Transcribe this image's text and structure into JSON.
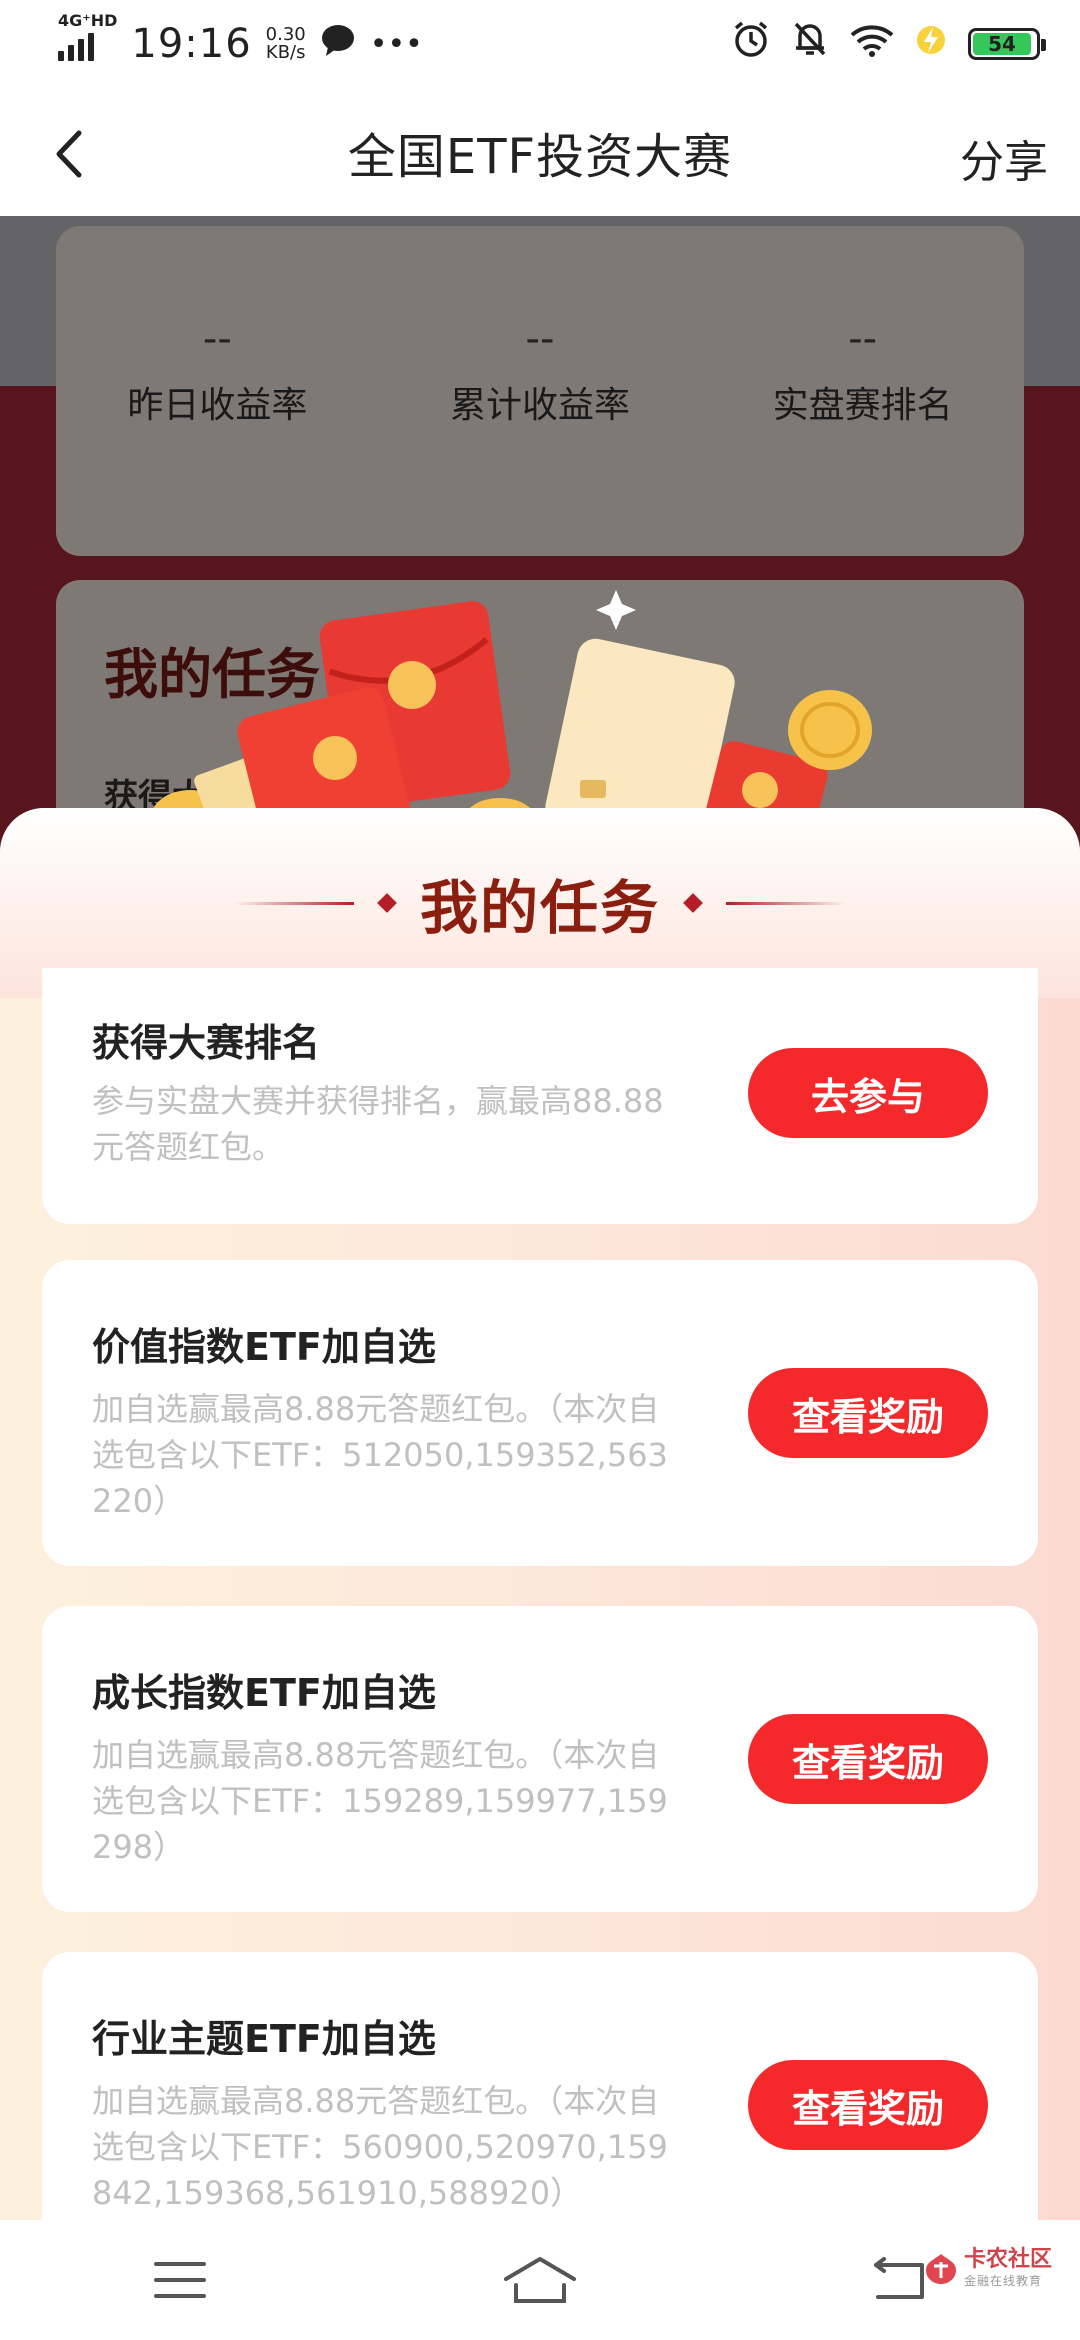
{
  "status_bar": {
    "network": "4G⁺HD",
    "time": "19:16",
    "speed_value": "0.30",
    "speed_unit": "KB/s",
    "more": "•••",
    "battery_level": "54",
    "battery_color": "#35c759"
  },
  "header": {
    "title": "全国ETF投资大赛",
    "share_label": "分享"
  },
  "stats": [
    {
      "value": "--",
      "label": "昨日收益率"
    },
    {
      "value": "--",
      "label": "累计收益率"
    },
    {
      "value": "--",
      "label": "实盘赛排名"
    }
  ],
  "bg_task": {
    "title": "我的任务",
    "first_item": "获得大赛排名"
  },
  "sheet": {
    "title": "我的任务",
    "tasks": [
      {
        "name": "获得大赛排名",
        "desc": "参与实盘大赛并获得排名，赢最高88.88元答题红包。",
        "button": "去参与"
      },
      {
        "name": "价值指数ETF加自选",
        "desc": "加自选赢最高8.88元答题红包。（本次自选包含以下ETF：512050,159352,563220）",
        "button": "查看奖励"
      },
      {
        "name": "成长指数ETF加自选",
        "desc": "加自选赢最高8.88元答题红包。（本次自选包含以下ETF：159289,159977,159298）",
        "button": "查看奖励"
      },
      {
        "name": "行业主题ETF加自选",
        "desc": "加自选赢最高8.88元答题红包。（本次自选包含以下ETF：560900,520970,159842,159368,561910,588920）",
        "button": "查看奖励"
      }
    ]
  },
  "watermark": {
    "name": "卡农社区",
    "sub": "金融在线教育"
  },
  "colors": {
    "accent_button": "#f5282b",
    "sheet_title": "#8a1f10"
  }
}
